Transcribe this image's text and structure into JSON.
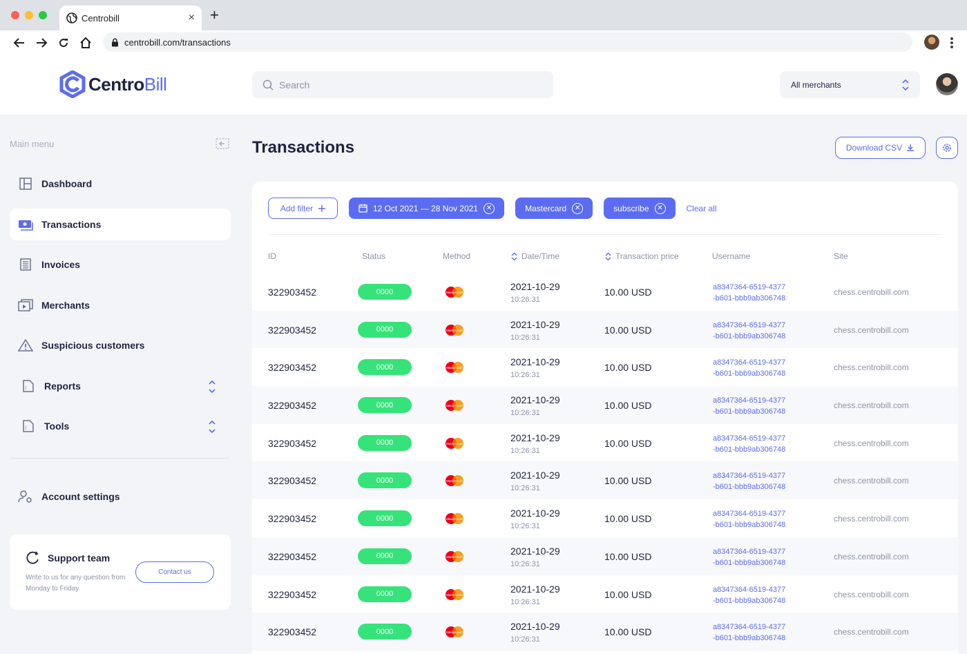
{
  "browser": {
    "tab_title": "Centrobill",
    "tab_close": "×",
    "new_tab": "+",
    "url": "centrobill.com/transactions"
  },
  "header": {
    "logo_part1": "Centro",
    "logo_part2": "Bill",
    "search_placeholder": "Search",
    "merchant_select": "All merchants"
  },
  "sidebar": {
    "title": "Main menu",
    "items": [
      {
        "label": "Dashboard",
        "icon": "dashboard-icon"
      },
      {
        "label": "Transactions",
        "icon": "transactions-icon",
        "active": true
      },
      {
        "label": "Invoices",
        "icon": "invoices-icon"
      },
      {
        "label": "Merchants",
        "icon": "merchants-icon"
      },
      {
        "label": "Suspicious customers",
        "icon": "warning-icon"
      },
      {
        "label": "Reports",
        "icon": "reports-icon",
        "expandable": true
      },
      {
        "label": "Tools",
        "icon": "tools-icon",
        "expandable": true
      }
    ],
    "account_settings": "Account settings",
    "support": {
      "title": "Support team",
      "description": "Write to us for any question from Monday to Friday",
      "contact_label": "Contact us"
    }
  },
  "main": {
    "title": "Transactions",
    "download_label": "Download CSV",
    "filters": {
      "add_label": "Add filter",
      "chips": [
        "12 Oct 2021 — 28 Nov 2021",
        "Mastercard",
        "subscribe"
      ],
      "clear_label": "Clear all"
    },
    "columns": [
      "ID",
      "Status",
      "Method",
      "Date/Time",
      "Transaction price",
      "Username",
      "Site"
    ],
    "rows": [
      {
        "id": "322903452",
        "status": "0000",
        "method": "Mastercard",
        "date": "2021-10-29",
        "time": "10:26:31",
        "price": "10.00 USD",
        "user1": "a8347364-6519-4377",
        "user2": "-b601-bbb9ab306748",
        "site": "chess.centrobill.com"
      },
      {
        "id": "322903452",
        "status": "0000",
        "method": "Mastercard",
        "date": "2021-10-29",
        "time": "10:26:31",
        "price": "10.00 USD",
        "user1": "a8347364-6519-4377",
        "user2": "-b601-bbb9ab306748",
        "site": "chess.centrobill.com"
      },
      {
        "id": "322903452",
        "status": "0000",
        "method": "Mastercard",
        "date": "2021-10-29",
        "time": "10:26:31",
        "price": "10.00 USD",
        "user1": "a8347364-6519-4377",
        "user2": "-b601-bbb9ab306748",
        "site": "chess.centrobill.com"
      },
      {
        "id": "322903452",
        "status": "0000",
        "method": "Mastercard",
        "date": "2021-10-29",
        "time": "10:26:31",
        "price": "10.00 USD",
        "user1": "a8347364-6519-4377",
        "user2": "-b601-bbb9ab306748",
        "site": "chess.centrobill.com"
      },
      {
        "id": "322903452",
        "status": "0000",
        "method": "Mastercard",
        "date": "2021-10-29",
        "time": "10:26:31",
        "price": "10.00 USD",
        "user1": "a8347364-6519-4377",
        "user2": "-b601-bbb9ab306748",
        "site": "chess.centrobill.com"
      },
      {
        "id": "322903452",
        "status": "0000",
        "method": "Mastercard",
        "date": "2021-10-29",
        "time": "10:26:31",
        "price": "10.00 USD",
        "user1": "a8347364-6519-4377",
        "user2": "-b601-bbb9ab306748",
        "site": "chess.centrobill.com"
      },
      {
        "id": "322903452",
        "status": "0000",
        "method": "Mastercard",
        "date": "2021-10-29",
        "time": "10:26:31",
        "price": "10.00 USD",
        "user1": "a8347364-6519-4377",
        "user2": "-b601-bbb9ab306748",
        "site": "chess.centrobill.com"
      },
      {
        "id": "322903452",
        "status": "0000",
        "method": "Mastercard",
        "date": "2021-10-29",
        "time": "10:26:31",
        "price": "10.00 USD",
        "user1": "a8347364-6519-4377",
        "user2": "-b601-bbb9ab306748",
        "site": "chess.centrobill.com"
      },
      {
        "id": "322903452",
        "status": "0000",
        "method": "Mastercard",
        "date": "2021-10-29",
        "time": "10:26:31",
        "price": "10.00 USD",
        "user1": "a8347364-6519-4377",
        "user2": "-b601-bbb9ab306748",
        "site": "chess.centrobill.com"
      },
      {
        "id": "322903452",
        "status": "0000",
        "method": "Mastercard",
        "date": "2021-10-29",
        "time": "10:26:31",
        "price": "10.00 USD",
        "user1": "a8347364-6519-4377",
        "user2": "-b601-bbb9ab306748",
        "site": "chess.centrobill.com"
      }
    ]
  },
  "colors": {
    "accent": "#5b6cf2",
    "status_ok": "#36e37a",
    "text_dark": "#1f2340",
    "text_muted": "#8d92a8"
  }
}
